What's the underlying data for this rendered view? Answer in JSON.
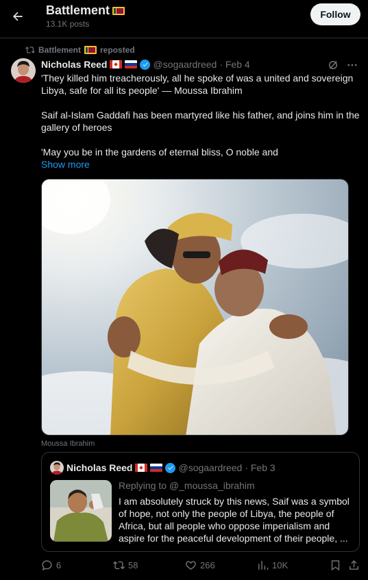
{
  "header": {
    "title": "Battlement",
    "posts_count": "13.1K posts",
    "follow_label": "Follow"
  },
  "repost": {
    "by": "Battlement",
    "label": "reposted"
  },
  "post": {
    "author_name": "Nicholas Reed",
    "handle": "@sogaardreed",
    "date": "· Feb 4",
    "paragraphs": [
      "'They killed him treacherously, all he spoke of was a united and sovereign Libya, safe for all its people' — Moussa Ibrahim",
      "Saif al-Islam Gaddafi has been martyred like his father, and joins him in the gallery of heroes",
      "'May you be in the gardens of eternal bliss, O noble and"
    ],
    "show_more": "Show more",
    "media_caption": "Moussa Ibrahim"
  },
  "quote": {
    "author_name": "Nicholas Reed",
    "handle": "@sogaardreed",
    "date": "· Feb 3",
    "reply_to": "Replying to @_moussa_ibrahim",
    "text": "I am absolutely struck by this news, Saif was a symbol of hope, not only the people of Libya, the people of Africa, but all people who oppose imperialism and aspire for the peaceful development of their people, ..."
  },
  "actions": {
    "replies": "6",
    "reposts": "58",
    "likes": "266",
    "views": "10K"
  },
  "colors": {
    "background": "#000000",
    "text": "#e7e9ea",
    "muted": "#71767b",
    "accent": "#1d9bf0",
    "border": "#2f3336",
    "follow_bg": "#eff3f4"
  },
  "icons": {
    "back": "arrow-left-icon",
    "repost": "repost-icon",
    "verified": "verified-badge-icon",
    "grok": "grok-icon",
    "more": "more-icon",
    "reply": "reply-icon",
    "like": "like-icon",
    "views": "views-icon",
    "bookmark": "bookmark-icon",
    "share": "share-icon",
    "flags": [
      "sri-lanka-flag-icon",
      "canada-flag-icon",
      "russia-flag-icon"
    ]
  }
}
